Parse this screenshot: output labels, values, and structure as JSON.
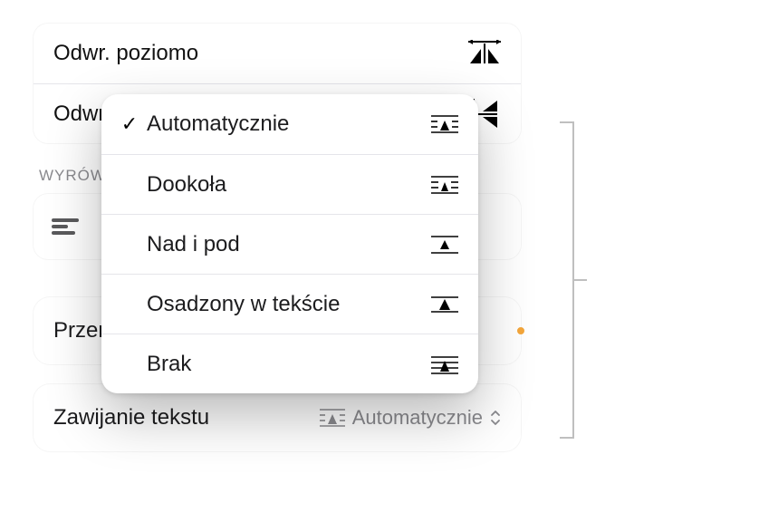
{
  "flip": {
    "horizontal_label": "Odwr. poziomo",
    "vertical_label": "Odwr. pionowo"
  },
  "align_section_label": "WYRÓWNAJ",
  "move_with_text_label": "Przenoszenie z tekstem",
  "wrap": {
    "label": "Zawijanie tekstu",
    "value": "Automatycznie"
  },
  "popup": {
    "items": [
      {
        "label": "Automatycznie",
        "selected": true
      },
      {
        "label": "Dookoła",
        "selected": false
      },
      {
        "label": "Nad i pod",
        "selected": false
      },
      {
        "label": "Osadzony w tekście",
        "selected": false
      },
      {
        "label": "Brak",
        "selected": false
      }
    ]
  }
}
